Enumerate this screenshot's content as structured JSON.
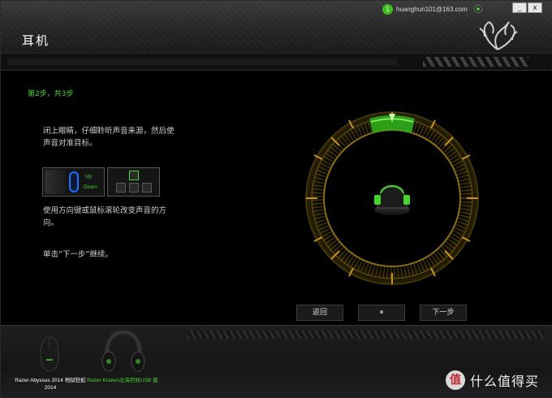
{
  "window": {
    "title": "耳机",
    "account_badge": "1",
    "account_email": "huanghun101@163.com",
    "minimize_label": "_",
    "close_label": "x"
  },
  "wizard": {
    "step": "第2步，共3步",
    "instruction_1": "闭上眼睛，仔细聆听声音来源，然后使声音对准目标。",
    "scroll_up": "Up",
    "scroll_down": "Down",
    "instruction_2": "使用方向键或鼠标滚轮改变声音的方向。",
    "instruction_3": "单击“下一步”继续。"
  },
  "controls": {
    "back_label": "返回",
    "pause_label": "⏸",
    "next_label": "下一步"
  },
  "devices": [
    {
      "name": "Razer Abyssus 2014 地狱狂蛇 2014",
      "active": false
    },
    {
      "name": "Razer Kraken北海巨妖USB 版",
      "active": true
    }
  ],
  "watermark": {
    "badge": "值",
    "text": "什么值得买"
  },
  "colors": {
    "accent": "#44d62c",
    "radar_ring": "#6b5a0c",
    "radar_tick": "#c8901a"
  }
}
